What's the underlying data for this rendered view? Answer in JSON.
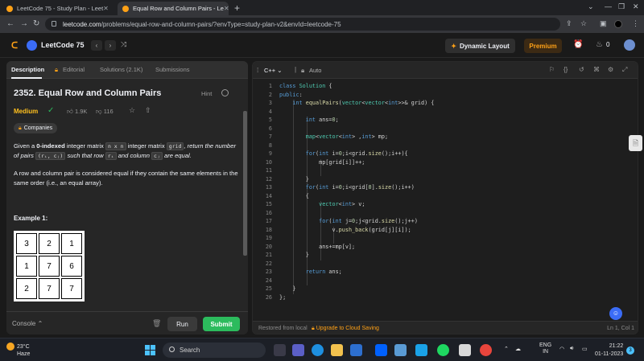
{
  "browser": {
    "tabs": [
      {
        "title": "LeetCode 75 - Study Plan - Leet"
      },
      {
        "title": "Equal Row and Column Pairs - Le"
      }
    ],
    "url_host": "leetcode.com",
    "url_path": "/problems/equal-row-and-column-pairs/?envType=study-plan-v2&envId=leetcode-75"
  },
  "navbar": {
    "title": "LeetCode 75",
    "dynamic_layout": "Dynamic Layout",
    "premium": "Premium",
    "fire_count": "0"
  },
  "left_tabs": [
    "Description",
    "Editorial",
    "Solutions (2.1K)",
    "Submissions"
  ],
  "problem": {
    "title": "2352. Equal Row and Column Pairs",
    "hint": "Hint",
    "difficulty": "Medium",
    "likes": "1.9K",
    "dislikes": "116",
    "companies": "Companies",
    "desc1_a": "Given a ",
    "desc1_b": "0-indexed",
    "desc1_c": " integer matrix ",
    "code_nxn": "n x n",
    "code_grid": "grid",
    "desc1_d": ", return the number of pairs",
    "code_pair": "(rᵢ, cⱼ)",
    "desc1_e": " such that row ",
    "code_ri": "rᵢ",
    "desc1_f": " and column ",
    "code_cj": "cⱼ",
    "desc1_g": " are equal.",
    "desc2": "A row and column pair is considered equal if they contain the same elements in the same order (i.e., an equal array).",
    "example_heading": "Example 1:",
    "grid": [
      [
        "3",
        "2",
        "1"
      ],
      [
        "1",
        "7",
        "6"
      ],
      [
        "2",
        "7",
        "7"
      ]
    ]
  },
  "bottom": {
    "console": "Console",
    "run": "Run",
    "submit": "Submit"
  },
  "editor": {
    "language": "C++",
    "auto": "Auto",
    "restored": "Restored from local",
    "upgrade": "Upgrade to Cloud Saving",
    "cursor": "Ln 1, Col 1",
    "lines": [
      "class Solution {",
      "public:",
      "    int equalPairs(vector<vector<int>>& grid) {",
      "",
      "        int ans=0;",
      "",
      "        map<vector<int> ,int> mp;",
      "",
      "        for(int i=0;i<grid.size();i++){",
      "            mp[grid[i]]++;",
      "",
      "        }",
      "        for(int i=0;i<grid[0].size();i++)",
      "        {",
      "            vector<int> v;",
      "",
      "            for(int j=0;j<grid.size();j++)",
      "                v.push_back(grid[j][i]);",
      "",
      "            ans+=mp[v];",
      "        }",
      "",
      "        return ans;",
      "",
      "    }",
      "};"
    ]
  },
  "taskbar": {
    "temp": "23°C",
    "weather": "Haze",
    "search": "Search",
    "lang_top": "ENG",
    "lang_bottom": "IN",
    "time": "21:22",
    "date": "01-11-2023",
    "notif": "3"
  }
}
